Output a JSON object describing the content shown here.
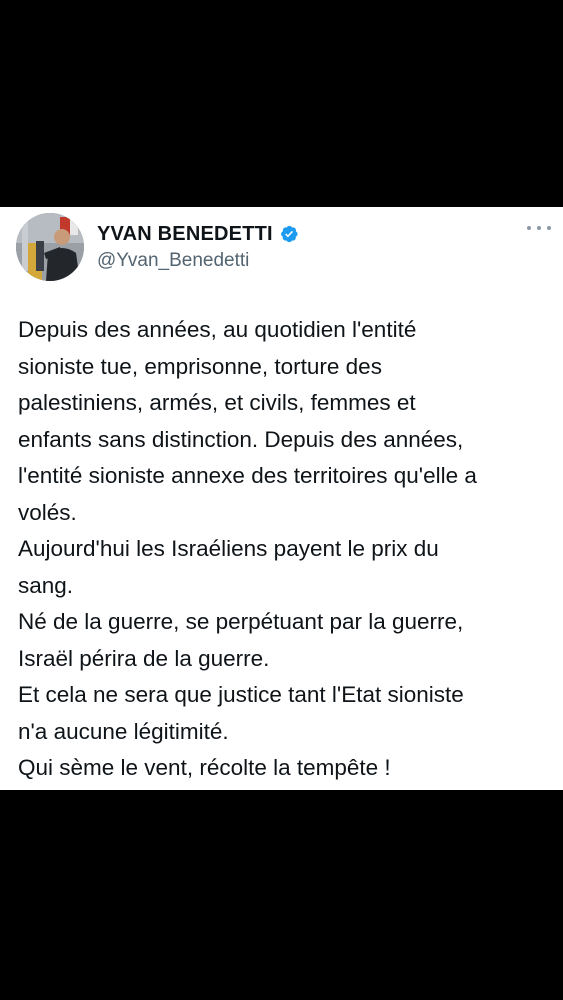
{
  "tweet": {
    "author": {
      "display_name": "YVAN BENEDETTI",
      "handle": "@Yvan_Benedetti",
      "verified": true,
      "avatar_icon": "profile-photo"
    },
    "more_icon": "more-horizontal-icon",
    "lines": [
      "Depuis des années, au quotidien l'entité",
      "sioniste tue, emprisonne, torture des",
      "palestiniens, armés, et civils, femmes et",
      "enfants sans distinction. Depuis des années,",
      "l'entité sioniste annexe des territoires qu'elle a",
      "volés.",
      "Aujourd'hui les Israéliens payent le prix du",
      "sang.",
      "Né de la guerre, se perpétuant par la guerre,",
      "Israël périra de la guerre.",
      "Et cela ne sera que justice tant l'Etat sioniste",
      "n'a aucune légitimité.",
      "Qui sème le vent, récolte la tempête !"
    ]
  },
  "colors": {
    "background": "#000000",
    "card": "#ffffff",
    "text": "#0f1419",
    "secondary_text": "#536471",
    "verified_badge": "#1d9bf0"
  }
}
